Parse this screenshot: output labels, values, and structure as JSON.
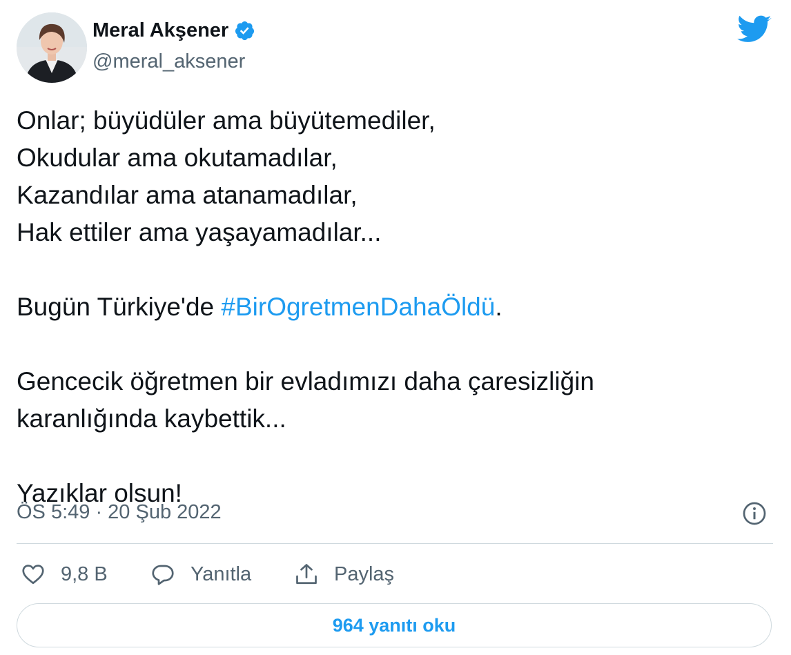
{
  "author": {
    "name": "Meral Akşener",
    "handle": "@meral_aksener",
    "verified_icon": "verified-badge-icon",
    "verified_color": "#1d9bf0"
  },
  "brand": {
    "icon": "twitter-bird-icon",
    "color": "#1d9bf0"
  },
  "tweet": {
    "lines": [
      "Onlar; büyüdüler ama büyütemediler,",
      "Okudular ama okutamadılar,",
      "Kazandılar ama atanamadılar,",
      "Hak ettiler ama yaşayamadılar..."
    ],
    "p2_prefix": "Bugün Türkiye'de ",
    "hashtag": "#BirOgretmenDahaÖldü",
    "p2_suffix": ".",
    "p3_lines": [
      "Gencecik öğretmen bir evladımızı daha çaresizliğin",
      "karanlığında kaybettik..."
    ],
    "p4": "Yazıklar olsun!",
    "hashtag_color": "#1d9bf0"
  },
  "timestamp": "ÖS 5:49 · 20 Şub 2022",
  "info_icon": "info-icon",
  "actions": {
    "like_icon": "heart-icon",
    "like_count": "9,8 B",
    "reply_icon": "reply-bubble-icon",
    "reply_label": "Yanıtla",
    "share_icon": "share-icon",
    "share_label": "Paylaş"
  },
  "read_replies_label": "964 yanıtı oku"
}
